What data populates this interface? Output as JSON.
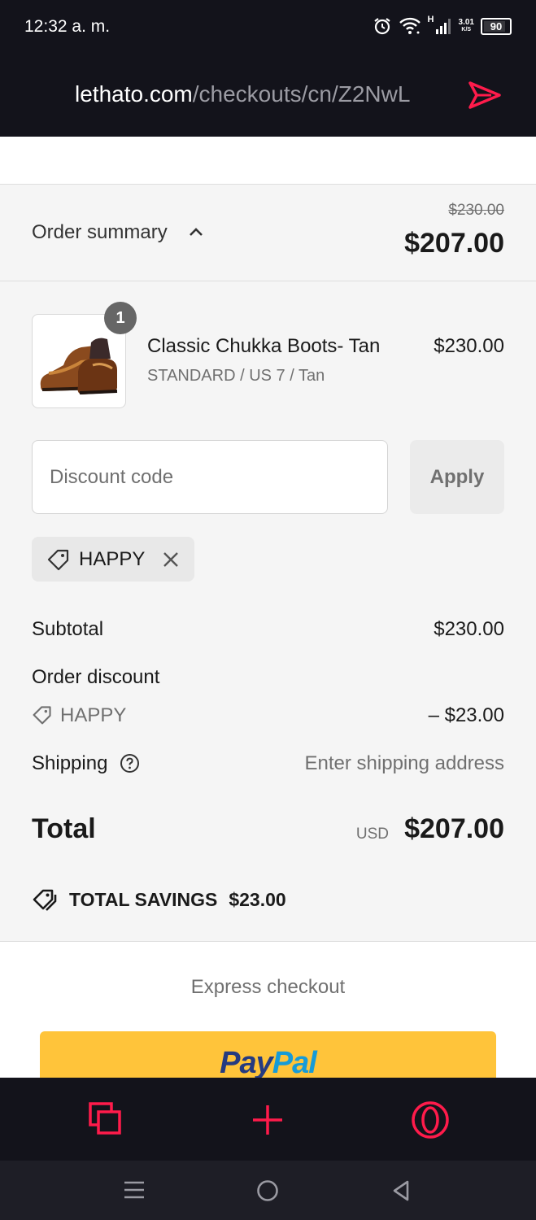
{
  "status_bar": {
    "time": "12:32 a. m.",
    "network_type": "H",
    "net_speed_value": "3.01",
    "net_speed_unit": "K/S",
    "battery": "90"
  },
  "browser": {
    "url_host": "lethato.com",
    "url_path": "/checkouts/cn/Z2NwL"
  },
  "order_summary": {
    "label": "Order summary",
    "original_total": "$230.00",
    "total": "$207.00"
  },
  "product": {
    "quantity": "1",
    "name": "Classic Chukka Boots- Tan",
    "variant": "STANDARD / US 7 / Tan",
    "price": "$230.00"
  },
  "discount": {
    "placeholder": "Discount code",
    "apply_label": "Apply",
    "applied_code": "HAPPY"
  },
  "totals": {
    "subtotal_label": "Subtotal",
    "subtotal_value": "$230.00",
    "order_discount_label": "Order discount",
    "discount_code": "HAPPY",
    "discount_value": "– $23.00",
    "shipping_label": "Shipping",
    "shipping_value": "Enter shipping address",
    "total_label": "Total",
    "currency": "USD",
    "total_value": "$207.00",
    "savings_label": "TOTAL SAVINGS",
    "savings_value": "$23.00"
  },
  "express": {
    "label": "Express checkout",
    "paypal_pay": "Pay",
    "paypal_pal": "Pal"
  },
  "colors": {
    "browser_accent": "#ff1b4b",
    "paypal_yellow": "#ffc43a"
  }
}
